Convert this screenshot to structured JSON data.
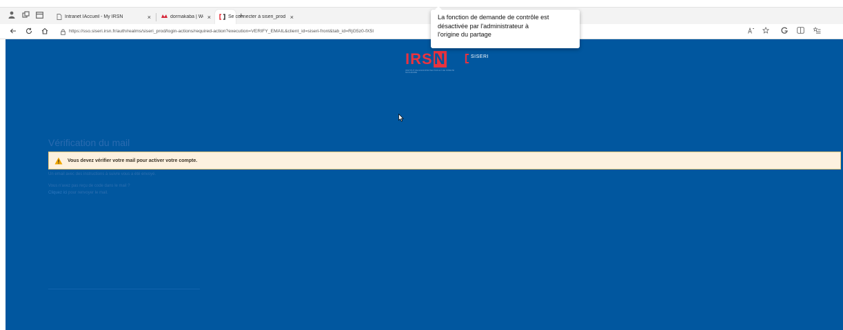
{
  "browser": {
    "tabs": [
      {
        "label": "Intranet IAccueil - My IRSN",
        "icon": "document-icon",
        "active": false
      },
      {
        "label": "dormakaba | WebTerminal",
        "icon": "dormakaba-icon",
        "active": false
      },
      {
        "label": "Se connecter à siseri_prod",
        "icon": "bracket-icon",
        "active": true
      }
    ],
    "close_glyph": "×",
    "new_tab_glyph": "+",
    "url": "https://sso.siseri.irsn.fr/auth/realms/siseri_prod/login-actions/required-action?execution=VERIFY_EMAIL&client_id=siseri-front&tab_id=RjG5z0-fX5I"
  },
  "page": {
    "logo": {
      "mark_prefix": "IRS",
      "mark_n": "N",
      "app_name": "SISERI",
      "tagline": "INSTITUT DE RADIOPROTECTION ET DE SÛRETÉ NUCLÉAIRE"
    },
    "title": "Vérification du mail",
    "alert": {
      "message": "Vous devez vérifier votre mail pour activer votre compte."
    },
    "info_text": "Un email avec des instructions à suivre vous a été envoyé.",
    "not_received_text": "Vous n'avez pas reçu de code dans le mail ?",
    "resend_link": "Cliquez ici",
    "resend_text": "pour renvoyer le mail."
  },
  "tooltip": {
    "lines": [
      "La fonction de demande de contrôle est",
      "désactivée par l'administrateur à",
      "l'origine du partage"
    ]
  },
  "colors": {
    "page_bg": "#01579f",
    "accent_red": "#e9333f",
    "alert_bg": "#fdf1df",
    "alert_border": "#f0c778"
  }
}
